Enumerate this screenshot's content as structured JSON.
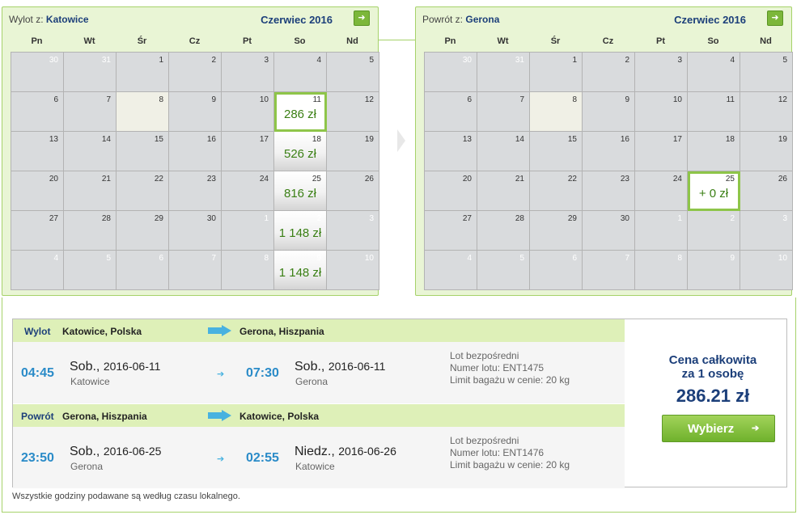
{
  "outbound_calendar": {
    "direction_label": "Wylot z:",
    "city": "Katowice",
    "month": "Czerwiec 2016",
    "weekdays": [
      "Pn",
      "Wt",
      "Śr",
      "Cz",
      "Pt",
      "So",
      "Nd"
    ],
    "days": [
      {
        "d": "30",
        "other": true
      },
      {
        "d": "31",
        "other": true
      },
      {
        "d": "1"
      },
      {
        "d": "2"
      },
      {
        "d": "3"
      },
      {
        "d": "4"
      },
      {
        "d": "5"
      },
      {
        "d": "6"
      },
      {
        "d": "7"
      },
      {
        "d": "8",
        "today": true
      },
      {
        "d": "9"
      },
      {
        "d": "10"
      },
      {
        "d": "11",
        "price": "286 zł",
        "selected": true
      },
      {
        "d": "12"
      },
      {
        "d": "13"
      },
      {
        "d": "14"
      },
      {
        "d": "15"
      },
      {
        "d": "16"
      },
      {
        "d": "17"
      },
      {
        "d": "18",
        "price": "526 zł"
      },
      {
        "d": "19"
      },
      {
        "d": "20"
      },
      {
        "d": "21"
      },
      {
        "d": "22"
      },
      {
        "d": "23"
      },
      {
        "d": "24"
      },
      {
        "d": "25",
        "price": "816 zł"
      },
      {
        "d": "26"
      },
      {
        "d": "27"
      },
      {
        "d": "28"
      },
      {
        "d": "29"
      },
      {
        "d": "30"
      },
      {
        "d": "1",
        "other": true
      },
      {
        "d": "2",
        "other": true,
        "price": "1 148 zł"
      },
      {
        "d": "3",
        "other": true
      },
      {
        "d": "4",
        "other": true
      },
      {
        "d": "5",
        "other": true
      },
      {
        "d": "6",
        "other": true
      },
      {
        "d": "7",
        "other": true
      },
      {
        "d": "8",
        "other": true
      },
      {
        "d": "9",
        "other": true,
        "price": "1 148 zł"
      },
      {
        "d": "10",
        "other": true
      }
    ]
  },
  "return_calendar": {
    "direction_label": "Powrót z:",
    "city": "Gerona",
    "month": "Czerwiec 2016",
    "weekdays": [
      "Pn",
      "Wt",
      "Śr",
      "Cz",
      "Pt",
      "So",
      "Nd"
    ],
    "days": [
      {
        "d": "30",
        "other": true
      },
      {
        "d": "31",
        "other": true
      },
      {
        "d": "1"
      },
      {
        "d": "2"
      },
      {
        "d": "3"
      },
      {
        "d": "4"
      },
      {
        "d": "5"
      },
      {
        "d": "6"
      },
      {
        "d": "7"
      },
      {
        "d": "8",
        "today": true
      },
      {
        "d": "9"
      },
      {
        "d": "10"
      },
      {
        "d": "11"
      },
      {
        "d": "12"
      },
      {
        "d": "13"
      },
      {
        "d": "14"
      },
      {
        "d": "15"
      },
      {
        "d": "16"
      },
      {
        "d": "17"
      },
      {
        "d": "18"
      },
      {
        "d": "19"
      },
      {
        "d": "20"
      },
      {
        "d": "21"
      },
      {
        "d": "22"
      },
      {
        "d": "23"
      },
      {
        "d": "24"
      },
      {
        "d": "25",
        "price": "+ 0 zł",
        "selected": true
      },
      {
        "d": "26"
      },
      {
        "d": "27"
      },
      {
        "d": "28"
      },
      {
        "d": "29"
      },
      {
        "d": "30"
      },
      {
        "d": "1",
        "other": true
      },
      {
        "d": "2",
        "other": true
      },
      {
        "d": "3",
        "other": true
      },
      {
        "d": "4",
        "other": true
      },
      {
        "d": "5",
        "other": true
      },
      {
        "d": "6",
        "other": true
      },
      {
        "d": "7",
        "other": true
      },
      {
        "d": "8",
        "other": true
      },
      {
        "d": "9",
        "other": true
      },
      {
        "d": "10",
        "other": true
      }
    ]
  },
  "summary": {
    "outbound": {
      "label": "Wylot",
      "from": "Katowice, Polska",
      "to": "Gerona, Hiszpania",
      "dep_time": "04:45",
      "dep_day": "Sob.,",
      "dep_date": "2016-06-11",
      "dep_city": "Katowice",
      "arr_time": "07:30",
      "arr_day": "Sob.,",
      "arr_date": "2016-06-11",
      "arr_city": "Gerona",
      "info1": "Lot bezpośredni",
      "info2": "Numer lotu: ENT1475",
      "info3": "Limit bagażu w cenie: 20 kg"
    },
    "return": {
      "label": "Powrót",
      "from": "Gerona, Hiszpania",
      "to": "Katowice, Polska",
      "dep_time": "23:50",
      "dep_day": "Sob.,",
      "dep_date": "2016-06-25",
      "dep_city": "Gerona",
      "arr_time": "02:55",
      "arr_day": "Niedz.,",
      "arr_date": "2016-06-26",
      "arr_city": "Katowice",
      "info1": "Lot bezpośredni",
      "info2": "Numer lotu: ENT1476",
      "info3": "Limit bagażu w cenie: 20 kg"
    },
    "price_label_1": "Cena całkowita",
    "price_label_2": "za 1 osobę",
    "total": "286.21 zł",
    "select_button": "Wybierz",
    "footnote": "Wszystkie godziny podawane są według czasu lokalnego."
  },
  "colors": {
    "accent_green": "#7cb73a",
    "panel_bg": "#e9f5d5",
    "navy": "#1c3f7a",
    "time_blue": "#2a8bc8",
    "arrow_blue": "#48b2e0"
  }
}
